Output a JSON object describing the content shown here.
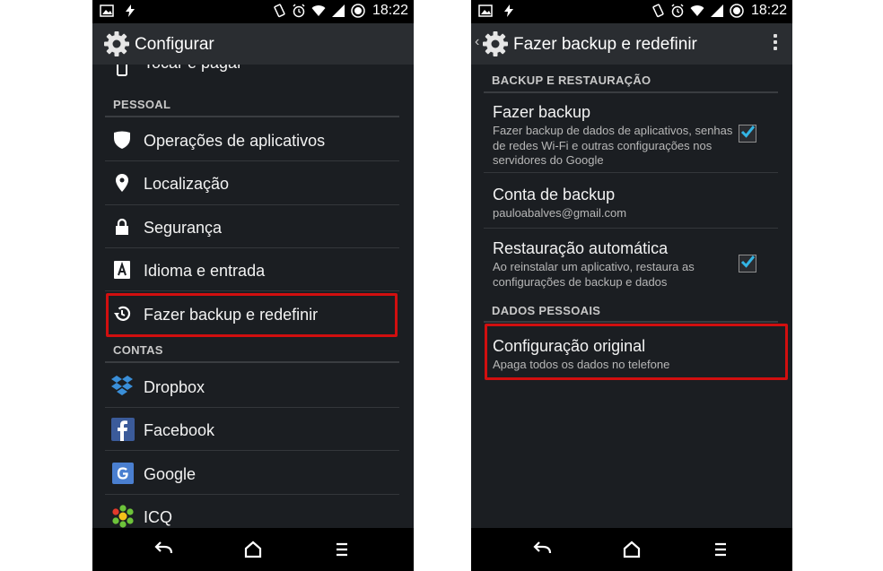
{
  "status_bar": {
    "time": "18:22"
  },
  "left": {
    "action_bar": {
      "title": "Configurar"
    },
    "partial_item": "Tocar e pagar",
    "sections": [
      {
        "header": "PESSOAL",
        "items": [
          {
            "label": "Operações de aplicativos",
            "icon": "shield-icon"
          },
          {
            "label": "Localização",
            "icon": "location-pin-icon"
          },
          {
            "label": "Segurança",
            "icon": "lock-icon"
          },
          {
            "label": "Idioma e entrada",
            "icon": "language-icon"
          },
          {
            "label": "Fazer backup e redefinir",
            "icon": "backup-restore-icon",
            "highlighted": true
          }
        ]
      },
      {
        "header": "CONTAS",
        "items": [
          {
            "label": "Dropbox",
            "icon": "dropbox-icon"
          },
          {
            "label": "Facebook",
            "icon": "facebook-icon"
          },
          {
            "label": "Google",
            "icon": "google-icon"
          },
          {
            "label": "ICQ",
            "icon": "icq-icon"
          }
        ]
      }
    ]
  },
  "right": {
    "action_bar": {
      "title": "Fazer backup e redefinir"
    },
    "sections": [
      {
        "header": "BACKUP E RESTAURAÇÃO",
        "items": [
          {
            "title": "Fazer backup",
            "summary": "Fazer backup de dados de aplicativos, senhas de redes Wi-Fi e outras configurações nos servidores do Google",
            "checked": true
          },
          {
            "title": "Conta de backup",
            "summary": "paulo​abalves@gmail.com"
          },
          {
            "title": "Restauração automática",
            "summary": "Ao reinstalar um aplicativo, restaura as configurações de backup e dados",
            "checked": true
          }
        ]
      },
      {
        "header": "DADOS PESSOAIS",
        "items": [
          {
            "title": "Configuração original",
            "summary": "Apaga todos os dados no telefone",
            "highlighted": true
          }
        ]
      }
    ]
  },
  "colors": {
    "background": "#1b1e22",
    "highlight": "#d10f0f",
    "checkmark": "#33b5e5"
  }
}
